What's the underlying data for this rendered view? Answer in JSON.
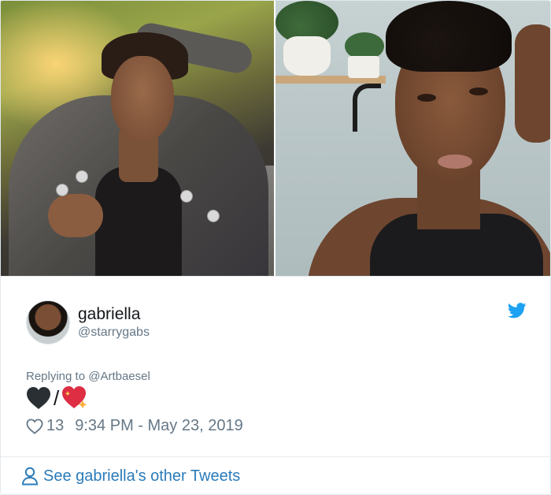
{
  "tweet": {
    "display_name": "gabriella",
    "handle": "@starrygabs",
    "reply_prefix": "Replying to",
    "reply_to": "@Artbaesel",
    "body_slash": "/",
    "like_count": "13",
    "timestamp": "9:34 PM - May 23, 2019"
  },
  "footer": {
    "link_label": "See gabriella's other Tweets"
  },
  "icons": {
    "brand": "twitter-bird-icon",
    "like": "heart-outline-icon",
    "profile": "person-outline-icon",
    "emoji_1": "black-heart-emoji",
    "emoji_2": "sparkling-heart-emoji"
  },
  "colors": {
    "link": "#2b7bb9",
    "muted": "#657786",
    "text": "#14171a",
    "brand": "#1da1f2"
  }
}
